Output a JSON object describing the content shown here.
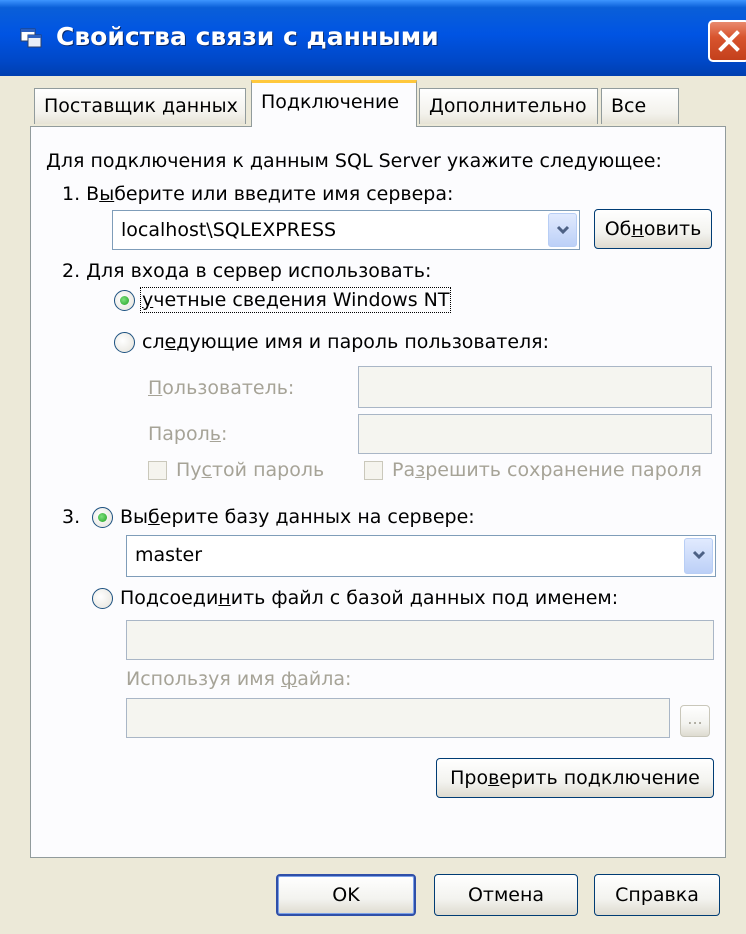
{
  "window": {
    "title": "Свойства связи с данными"
  },
  "tabs": [
    {
      "label": "Поставщик данных",
      "active": false
    },
    {
      "label": "Подключение",
      "active": true
    },
    {
      "label": "Дополнительно",
      "active": false
    },
    {
      "label": "Все",
      "active": false
    }
  ],
  "panel": {
    "intro": "Для подключения к данным SQL Server укажите следующее:",
    "step1": {
      "label_prefix": "1. В",
      "label_accel": "ы",
      "label_suffix": "берите или введите имя сервера:",
      "server_value": "localhost\\SQLEXPRESS",
      "refresh_prefix": "Об",
      "refresh_accel": "н",
      "refresh_suffix": "овить"
    },
    "step2": {
      "label": "2. Для входа в сервер использовать:",
      "option_windows_accel": "у",
      "option_windows_rest": "четные сведения Windows NT",
      "option_user_prefix": "сл",
      "option_user_accel": "е",
      "option_user_suffix": "дующие имя и пароль пользователя:",
      "user_label_accel": "П",
      "user_label_rest": "ользователь:",
      "password_label_prefix": "Парол",
      "password_label_accel": "ь",
      "password_label_suffix": ":",
      "blank_password_prefix": "Пу",
      "blank_password_accel": "с",
      "blank_password_suffix": "той пароль",
      "allow_save_prefix": "Ра",
      "allow_save_accel": "з",
      "allow_save_suffix": "решить сохранение пароля"
    },
    "step3": {
      "number": "3.",
      "option_db_prefix": "Вы",
      "option_db_accel": "б",
      "option_db_suffix": "ерите базу данных на сервере:",
      "database_value": "master",
      "option_attach_prefix": "Подсоеди",
      "option_attach_accel": "н",
      "option_attach_suffix": "ить файл с базой данных под именем:",
      "filename_label_prefix": "Используя имя ",
      "filename_label_accel": "ф",
      "filename_label_suffix": "айла:",
      "browse_label": "..."
    },
    "test_prefix": "Про",
    "test_accel": "в",
    "test_suffix": "ерить подключение"
  },
  "footer": {
    "ok": "OK",
    "cancel": "Отмена",
    "help": "Справка"
  }
}
